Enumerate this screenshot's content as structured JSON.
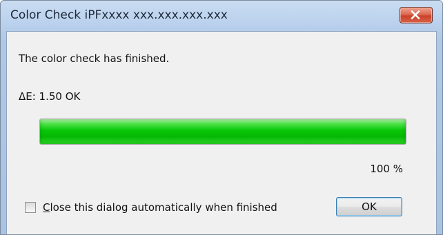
{
  "window": {
    "title": "Color Check iPFxxxx xxx.xxx.xxx.xxx"
  },
  "dialog": {
    "message": "The color check has finished.",
    "delta_e": "ΔE: 1.50 OK",
    "progress": {
      "percent_label": "100 %",
      "fraction": 1.0
    },
    "checkbox": {
      "label_accel": "C",
      "label_rest": "lose this dialog automatically when finished",
      "checked": false
    },
    "ok_label": "OK"
  },
  "icons": {
    "close": "close-icon"
  },
  "colors": {
    "progress_fill": "#07c707",
    "close_button": "#c8432a"
  }
}
